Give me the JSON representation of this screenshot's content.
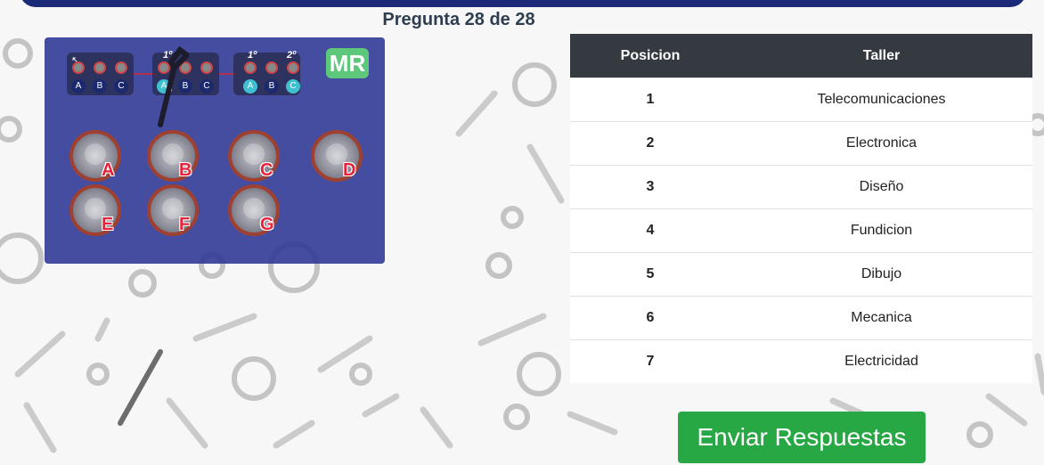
{
  "question_counter": "Pregunta 28 de 28",
  "instructions_panel": {
    "mode_badge": "MR",
    "step1": {
      "labels": [
        "A",
        "B",
        "C"
      ]
    },
    "step2": {
      "order": "1º",
      "labels": [
        "A",
        "B",
        "C"
      ],
      "selected": "A"
    },
    "step3": {
      "order_first": "1º",
      "order_second": "2º",
      "labels": [
        "A",
        "B",
        "C"
      ],
      "selected": [
        "A",
        "C"
      ]
    }
  },
  "options": [
    "A",
    "B",
    "C",
    "D",
    "E",
    "F",
    "G"
  ],
  "ranking_table": {
    "headers": {
      "position": "Posicion",
      "workshop": "Taller"
    },
    "rows": [
      {
        "pos": "1",
        "taller": "Telecomunicaciones"
      },
      {
        "pos": "2",
        "taller": "Electronica"
      },
      {
        "pos": "3",
        "taller": "Diseño"
      },
      {
        "pos": "4",
        "taller": "Fundicion"
      },
      {
        "pos": "5",
        "taller": "Dibujo"
      },
      {
        "pos": "6",
        "taller": "Mecanica"
      },
      {
        "pos": "7",
        "taller": "Electricidad"
      }
    ]
  },
  "submit_label": "Enviar Respuestas",
  "colors": {
    "header_bar": "#1a2a78",
    "panel": "#303a96",
    "submit": "#28a745",
    "table_header": "#343a40",
    "option_label": "#e8223a"
  },
  "background_pattern": "tools-doodle (gears, wrenches, bolts, nuts)"
}
